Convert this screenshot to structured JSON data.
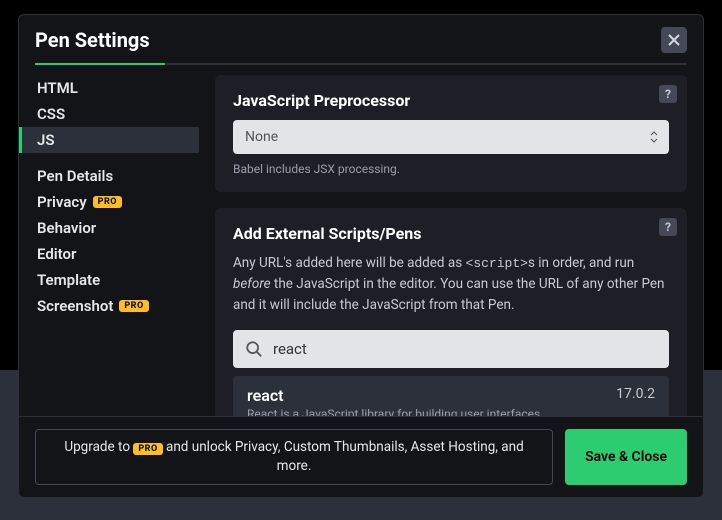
{
  "header": {
    "title": "Pen Settings"
  },
  "sidebar": {
    "items": [
      "HTML",
      "CSS",
      "JS",
      "Pen Details",
      "Privacy",
      "Behavior",
      "Editor",
      "Template",
      "Screenshot"
    ],
    "pro_label": "PRO"
  },
  "panel1": {
    "title": "JavaScript Preprocessor",
    "select_value": "None",
    "hint": "Babel includes JSX processing."
  },
  "panel2": {
    "title": "Add External Scripts/Pens",
    "desc_1": "Any URL's added here will be added as ",
    "desc_code": "<script>",
    "desc_2": "s in order, and run ",
    "desc_em": "before",
    "desc_3": " the JavaScript in the editor. You can use the URL of any other Pen and it will include the JavaScript from that Pen.",
    "search_value": "react",
    "result": {
      "name": "react",
      "desc": "React is a JavaScript library for building user interfaces.",
      "version": "17.0.2"
    }
  },
  "footer": {
    "upsell_1": "Upgrade to ",
    "upsell_2": " and unlock Privacy, Custom Thumbnails, Asset Hosting, and more.",
    "save": "Save & Close"
  }
}
